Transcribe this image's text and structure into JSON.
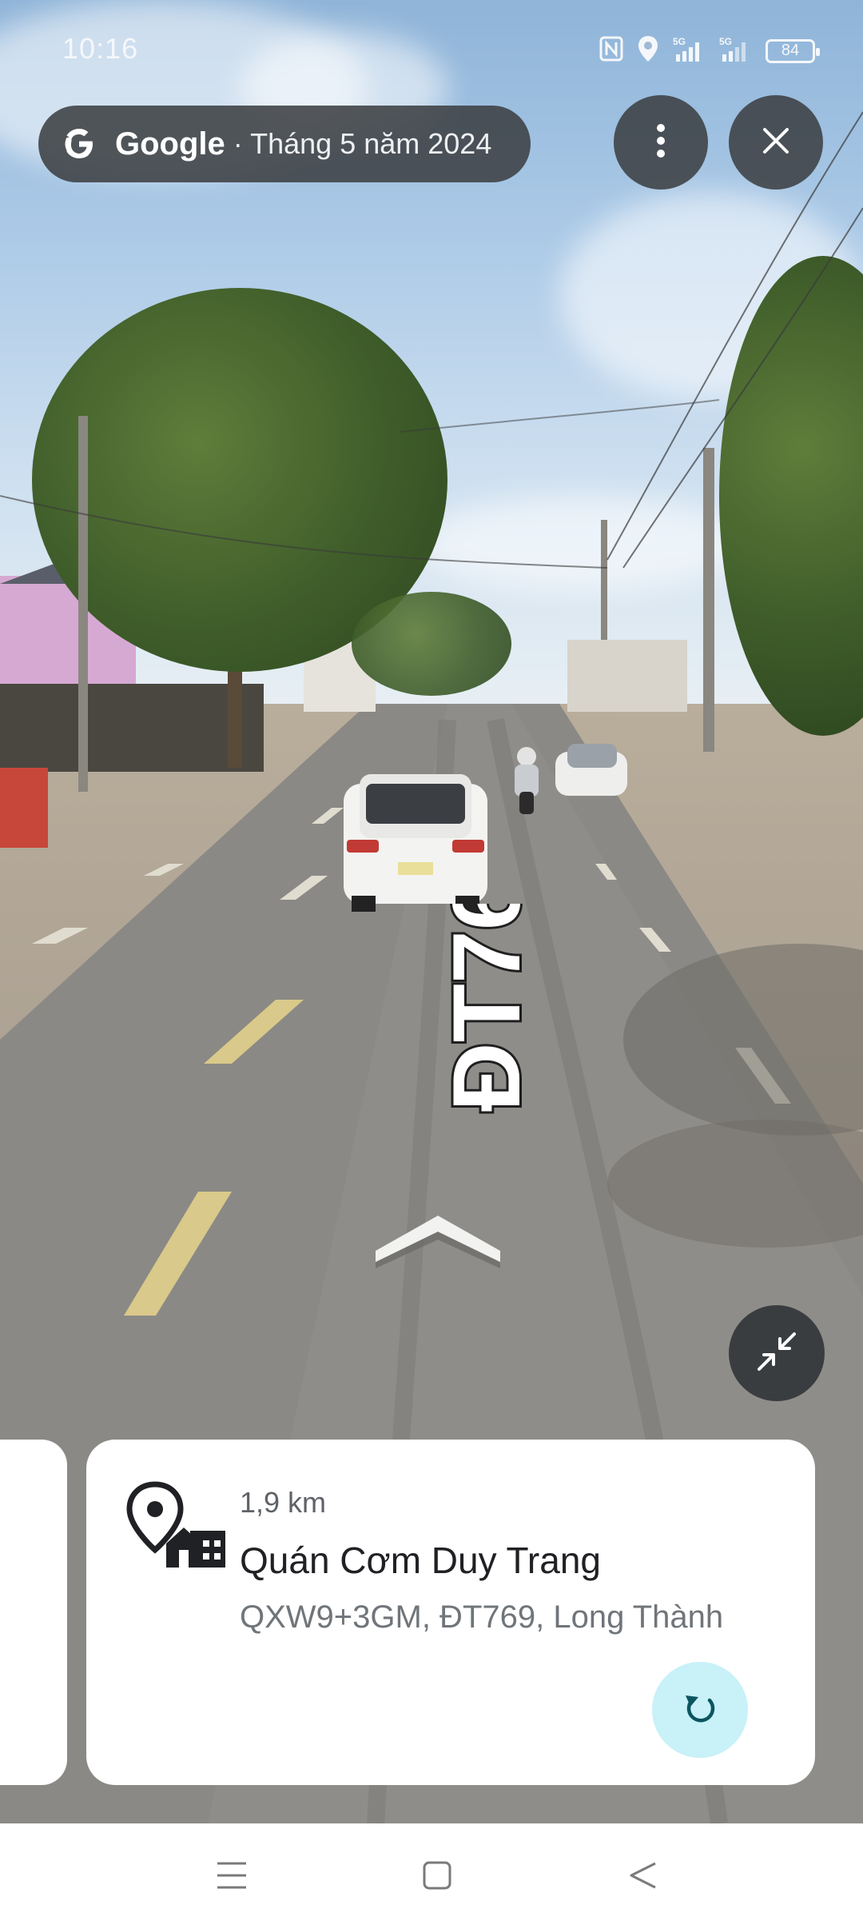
{
  "status_bar": {
    "time": "10:16",
    "battery": "84",
    "icons": [
      "nfc-icon",
      "location-icon",
      "signal-5g-icon",
      "signal-5g-icon"
    ]
  },
  "header": {
    "brand": "Google",
    "date": "· Tháng 5 năm 2024",
    "more_icon": "more-vert-icon",
    "close_icon": "close-icon"
  },
  "street_view": {
    "road_label": "ĐT769",
    "forward_icon": "chevron-up-icon",
    "collapse_icon": "collapse-icon"
  },
  "place_card": {
    "distance": "1,9 km",
    "name": "Quán Cơm Duy Trang",
    "address": "QXW9+3GM, ĐT769, Long Thành",
    "icon": "place-building-icon",
    "refresh_icon": "refresh-icon"
  },
  "colors": {
    "chip_bg": "#3c4043",
    "refresh_bg": "#c8f1f8",
    "refresh_fg": "#0b5560"
  }
}
